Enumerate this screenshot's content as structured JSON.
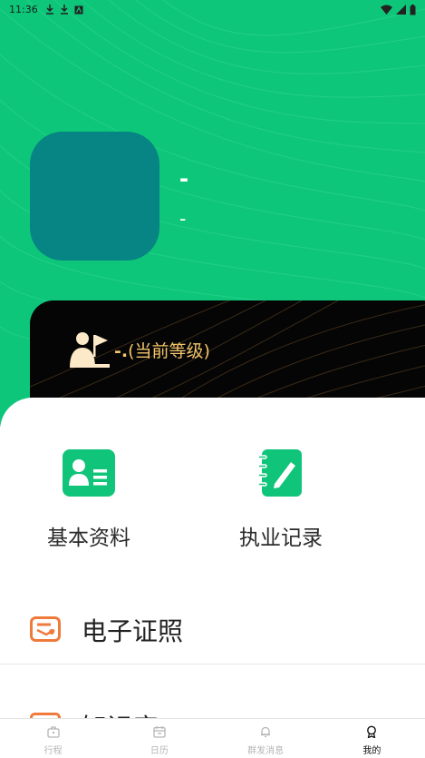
{
  "status_bar": {
    "time": "11:36",
    "left_icons": [
      "download-icon",
      "download-icon",
      "app-notification-icon"
    ],
    "right_icons": [
      "wifi-icon",
      "signal-icon",
      "battery-icon"
    ]
  },
  "profile": {
    "name": "-",
    "subtitle": "-"
  },
  "level": {
    "value": "-.",
    "caption": "(当前等级)"
  },
  "grid": [
    {
      "label": "基本资料",
      "icon": "id-card-icon"
    },
    {
      "label": "执业记录",
      "icon": "notebook-edit-icon"
    }
  ],
  "list": [
    {
      "label": "电子证照",
      "icon": "certificate-icon"
    },
    {
      "label": "知识库",
      "icon": "image-icon"
    }
  ],
  "tabs": [
    {
      "label": "行程",
      "icon": "briefcase-icon",
      "active": false
    },
    {
      "label": "日历",
      "icon": "calendar-icon",
      "active": false
    },
    {
      "label": "群发消息",
      "icon": "bell-icon",
      "active": false
    },
    {
      "label": "我的",
      "icon": "profile-badge-icon",
      "active": true
    }
  ],
  "colors": {
    "header_green": "#0ec67a",
    "avatar_teal": "#078584",
    "level_gold": "#f3c46a",
    "accent_orange": "#f07a3c"
  }
}
